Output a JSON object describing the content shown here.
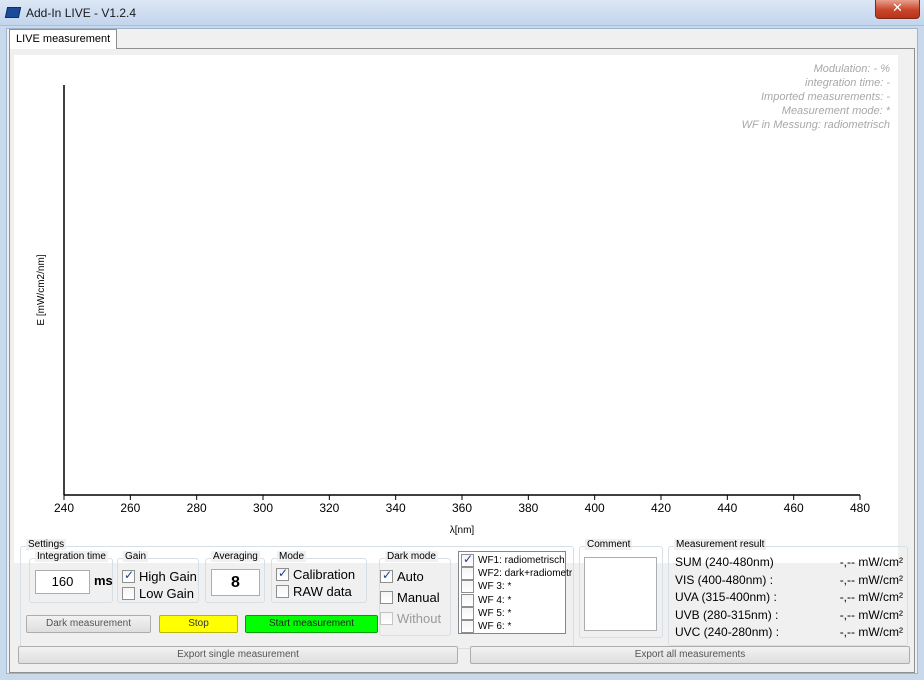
{
  "window": {
    "title": "Add-In LIVE - V1.2.4",
    "close_glyph": "✕"
  },
  "tabs": [
    {
      "label": "LIVE measurement"
    }
  ],
  "info": [
    "Modulation: - %",
    "integration time: -",
    "Imported measurements: -",
    "Measurement mode: *",
    "WF in Messung: radiometrisch"
  ],
  "chart_data": {
    "type": "line",
    "xlabel": "λ[nm]",
    "ylabel": "E [mW/cm2/nm]",
    "xlim": [
      240,
      480
    ],
    "x_ticks": [
      240,
      260,
      280,
      300,
      320,
      340,
      360,
      380,
      400,
      420,
      440,
      460,
      480
    ],
    "series": [],
    "grid": false
  },
  "settings": {
    "title": "Settings",
    "integration": {
      "title": "Integration time",
      "value": "160",
      "unit": "ms"
    },
    "gain": {
      "title": "Gain",
      "options": [
        {
          "label": "High Gain",
          "checked": true
        },
        {
          "label": "Low Gain",
          "checked": false
        }
      ]
    },
    "averaging": {
      "title": "Averaging",
      "value": "8"
    },
    "mode": {
      "title": "Mode",
      "options": [
        {
          "label": "Calibration",
          "checked": true
        },
        {
          "label": "RAW data",
          "checked": false
        }
      ]
    },
    "dark_mode": {
      "title": "Dark mode",
      "options": [
        {
          "label": "Auto",
          "checked": true
        },
        {
          "label": "Manual",
          "checked": false
        },
        {
          "label": "Without",
          "checked": false,
          "disabled": true
        }
      ]
    },
    "buttons": {
      "dark": "Dark measurement",
      "stop": "Stop",
      "start": "Start measurement"
    }
  },
  "wf_list": [
    {
      "label": "WF1: radiometrisch",
      "checked": true
    },
    {
      "label": "WF2: dark+radiometr",
      "checked": false
    },
    {
      "label": "WF 3: *",
      "checked": false
    },
    {
      "label": "WF 4: *",
      "checked": false
    },
    {
      "label": "WF 5: *",
      "checked": false
    },
    {
      "label": "WF 6: *",
      "checked": false
    }
  ],
  "comment": {
    "title": "Comment",
    "value": ""
  },
  "results": {
    "title": "Measurement result",
    "rows": [
      {
        "label": "SUM (240-480nm)",
        "value": "-,-- mW/cm²"
      },
      {
        "label": "VIS (400-480nm) :",
        "value": "-,-- mW/cm²"
      },
      {
        "label": "UVA (315-400nm) :",
        "value": "-,-- mW/cm²"
      },
      {
        "label": "UVB (280-315nm) :",
        "value": "-,-- mW/cm²"
      },
      {
        "label": "UVC (240-280nm) :",
        "value": "-,-- mW/cm²"
      }
    ]
  },
  "export": {
    "single": "Export single measurement",
    "all": "Export all measurements"
  }
}
